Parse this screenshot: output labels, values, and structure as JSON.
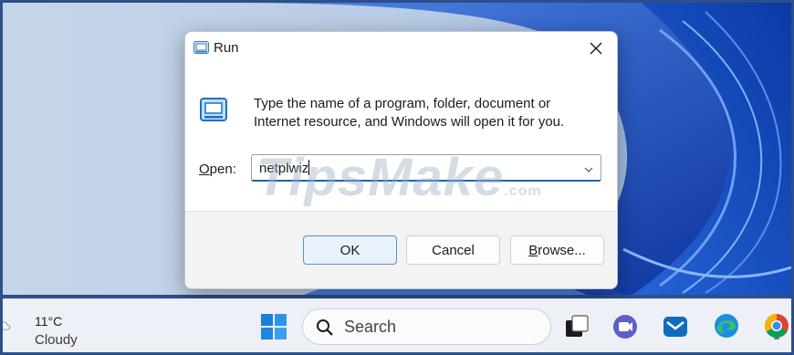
{
  "dialog": {
    "title": "Run",
    "description_line1": "Type the name of a program, folder, document or",
    "description_line2": "Internet resource, and Windows will open it for you.",
    "open_label_accel": "O",
    "open_label_rest": "pen:",
    "open_value": "netplwiz",
    "buttons": {
      "ok": "OK",
      "cancel": "Cancel",
      "browse_accel": "B",
      "browse_rest": "rowse..."
    },
    "icons": {
      "title": "run-icon",
      "body": "run-large-icon",
      "close": "close-icon",
      "dropdown": "chevron-down-icon"
    }
  },
  "taskbar": {
    "weather": {
      "temperature": "11°C",
      "condition": "Cloudy",
      "icon": "cloud-icon"
    },
    "search_placeholder": "Search",
    "apps": [
      "windows-start-icon",
      "search-icon",
      "frog-highlight-image",
      "task-view-icon",
      "meet-icon",
      "mail-icon",
      "edge-icon",
      "chrome-icon"
    ]
  },
  "watermark": {
    "main": "TipsMake",
    "suffix": ".com"
  },
  "colors": {
    "accent": "#1d62b6",
    "wallpaper_dark": "#0b3a9e",
    "taskbar_bg": "#edf1f7"
  }
}
